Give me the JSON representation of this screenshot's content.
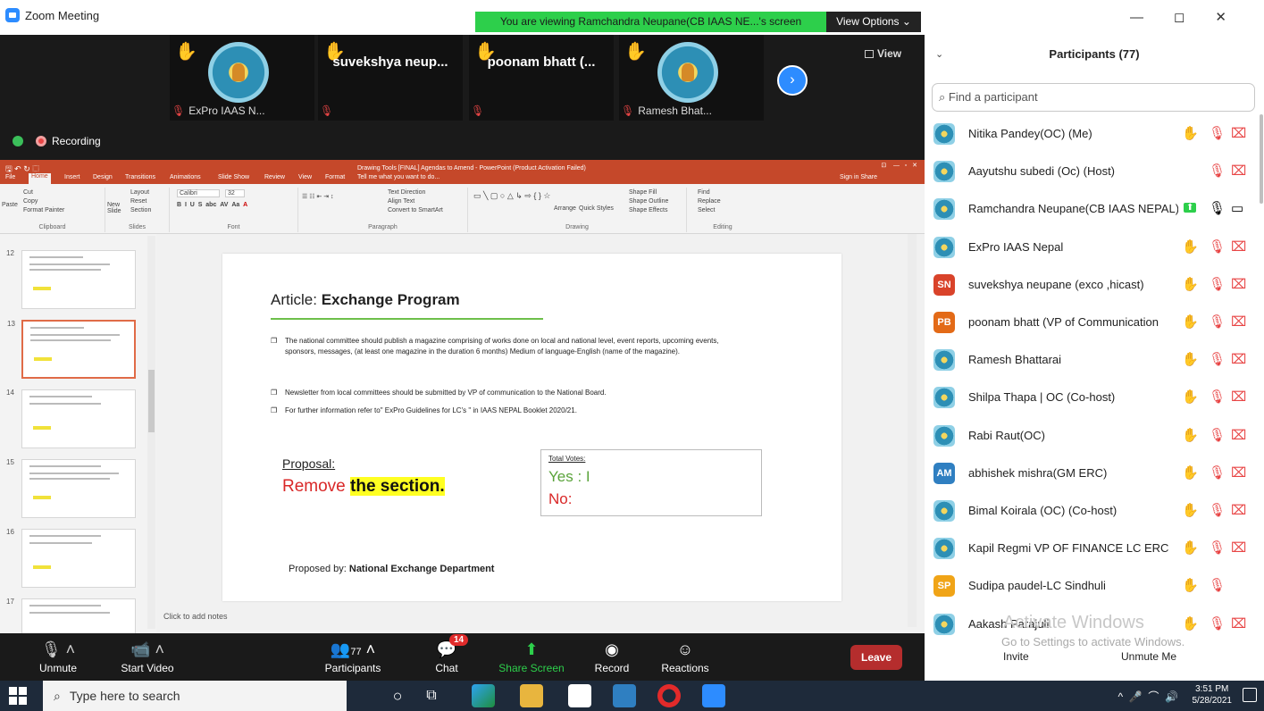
{
  "window": {
    "title": "Zoom Meeting",
    "viewing_banner": "You are viewing Ramchandra  Neupane(CB IAAS NE...'s screen",
    "view_options": "View Options ⌄"
  },
  "gallery": {
    "tiles": [
      {
        "name": "",
        "caption": "ExPro IAAS N..."
      },
      {
        "name": "suvekshya  neup...",
        "caption": ""
      },
      {
        "name": "poonam  bhatt (...",
        "caption": ""
      },
      {
        "name": "",
        "caption": "Ramesh Bhat..."
      }
    ],
    "view_label": "View",
    "recording_label": "Recording"
  },
  "ppt": {
    "doc_title": "Drawing Tools   [FINAL] Agendas to Amend - PowerPoint (Product Activation Failed)",
    "tabs": [
      "File",
      "Home",
      "Insert",
      "Design",
      "Transitions",
      "Animations",
      "Slide Show",
      "Review",
      "View",
      "Format",
      "Tell me what you want to do..."
    ],
    "sign_in": "Sign in   Share",
    "ribbon": {
      "clipboard": [
        "Cut",
        "Copy",
        "Format Painter",
        "Paste"
      ],
      "clipboard_label": "Clipboard",
      "slides": [
        "Layout",
        "Reset",
        "Section",
        "New Slide"
      ],
      "slides_label": "Slides",
      "font_name": "Calibri",
      "font_size": "32",
      "font_label": "Font",
      "paragraph": [
        "Text Direction",
        "Align Text",
        "Convert to SmartArt"
      ],
      "paragraph_label": "Paragraph",
      "drawing": [
        "Arrange",
        "Quick Styles",
        "Shape Fill",
        "Shape Outline",
        "Shape Effects"
      ],
      "drawing_label": "Drawing",
      "editing": [
        "Find",
        "Replace",
        "Select"
      ],
      "editing_label": "Editing"
    },
    "slide_numbers": [
      "12",
      "13",
      "14",
      "15",
      "16",
      "17"
    ],
    "slide": {
      "title_prefix": "Article: ",
      "title_bold": "Exchange Program",
      "bullets": [
        "The national committee should publish a magazine comprising of works done on local and national level, event reports, upcoming events, sponsors, messages, (at least one magazine in the duration 6 months) Medium of language-English (name of the magazine).",
        "Newsletter from local committees should be submitted by VP of communication to the National Board.",
        "For further information refer to\" ExPro Guidelines for LC's \" in IAAS NEPAL Booklet 2020/21."
      ],
      "proposal_label": "Proposal:",
      "remove_prefix": "Remove ",
      "remove_highlight": "the section.",
      "votes_title": "Total Votes:",
      "yes": "Yes : I",
      "no": "No:",
      "proposed_prefix": "Proposed by: ",
      "proposed_bold": "National Exchange Department"
    },
    "notes_placeholder": "Click to add notes"
  },
  "controls": {
    "unmute": "Unmute",
    "start_video": "Start Video",
    "participants": "Participants",
    "participants_count": "77",
    "chat": "Chat",
    "chat_badge": "14",
    "share_screen": "Share Screen",
    "record": "Record",
    "reactions": "Reactions",
    "leave": "Leave"
  },
  "panel": {
    "title": "Participants (77)",
    "search_placeholder": "Find a participant",
    "participants": [
      {
        "name": "Nitika Pandey(OC) (Me)",
        "avatar": "img",
        "hand": true,
        "mic": "muted",
        "video": "off"
      },
      {
        "name": "Aayutshu subedi (Oc) (Host)",
        "avatar": "img",
        "hand": false,
        "mic": "muted",
        "video": "off"
      },
      {
        "name": "Ramchandra  Neupane(CB IAAS NEPAL)",
        "avatar": "img",
        "hand": false,
        "mic": "on",
        "video": "on",
        "sharing": true
      },
      {
        "name": "ExPro IAAS Nepal",
        "avatar": "img",
        "hand": true,
        "mic": "muted",
        "video": "off"
      },
      {
        "name": "suvekshya neupane (exco ,hicast)",
        "avatar": "SN",
        "avatar_color": "#d9432a",
        "hand": true,
        "mic": "muted",
        "video": "off"
      },
      {
        "name": "poonam bhatt (VP of Communication",
        "avatar": "PB",
        "avatar_color": "#e36a17",
        "hand": true,
        "mic": "muted",
        "video": "off"
      },
      {
        "name": "Ramesh Bhattarai",
        "avatar": "img",
        "hand": true,
        "mic": "muted",
        "video": "off"
      },
      {
        "name": "Shilpa Thapa | OC (Co-host)",
        "avatar": "img",
        "hand": true,
        "mic": "muted",
        "video": "off"
      },
      {
        "name": "Rabi Raut(OC)",
        "avatar": "img",
        "hand": true,
        "mic": "muted",
        "video": "off"
      },
      {
        "name": "abhishek mishra(GM ERC)",
        "avatar": "AM",
        "avatar_color": "#2f7fc1",
        "hand": true,
        "mic": "muted",
        "video": "off"
      },
      {
        "name": "Bimal Koirala  (OC) (Co-host)",
        "avatar": "img",
        "hand": true,
        "mic": "muted",
        "video": "off"
      },
      {
        "name": "Kapil Regmi VP OF FINANCE LC ERC",
        "avatar": "img",
        "hand": true,
        "mic": "muted",
        "video": "off"
      },
      {
        "name": "Sudipa paudel-LC Sindhuli",
        "avatar": "SP",
        "avatar_color": "#f0a417",
        "hand": true,
        "mic": "muted",
        "video": ""
      },
      {
        "name": "Aakash Parajuli",
        "avatar": "img",
        "hand": true,
        "mic": "muted",
        "video": "off"
      }
    ],
    "activate_windows": "Activate Windows",
    "activate_sub": "Go to Settings to activate Windows.",
    "invite": "Invite",
    "unmute_me": "Unmute Me"
  },
  "taskbar": {
    "search_placeholder": "Type here to search",
    "time": "3:51 PM",
    "date": "5/28/2021"
  }
}
